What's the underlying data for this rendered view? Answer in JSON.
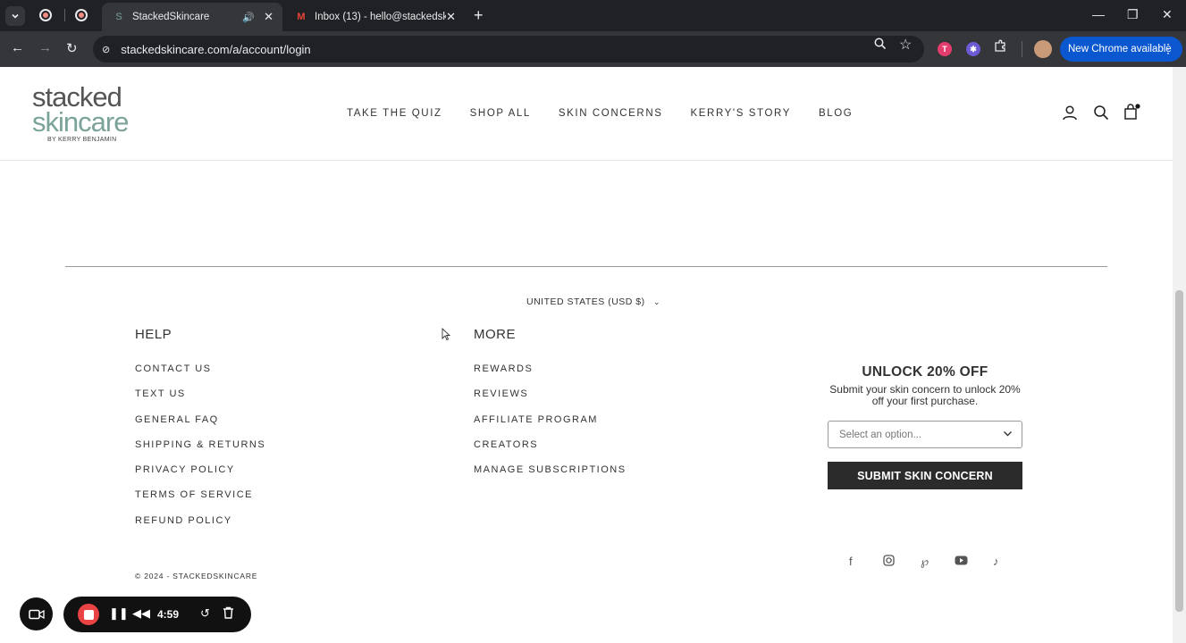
{
  "browser": {
    "tabs": [
      {
        "title": "StackedSkincare",
        "favicon": "S",
        "active": true
      },
      {
        "title": "Inbox (13) - hello@stackedskinc",
        "favicon": "M",
        "active": false
      }
    ],
    "url": "stackedskincare.com/a/account/login",
    "chrome_available_label": "New Chrome available",
    "extension_badge": "T"
  },
  "site": {
    "logo": {
      "line1": "stacked",
      "line2": "skincare",
      "line3": "BY KERRY BENJAMIN"
    },
    "nav": [
      {
        "label": "TAKE THE QUIZ"
      },
      {
        "label": "SHOP ALL"
      },
      {
        "label": "SKIN CONCERNS"
      },
      {
        "label": "KERRY'S STORY"
      },
      {
        "label": "BLOG"
      }
    ]
  },
  "footer": {
    "currency": "UNITED STATES (USD $)",
    "help": {
      "title": "HELP",
      "links": [
        "CONTACT US",
        "TEXT US",
        "GENERAL FAQ",
        "SHIPPING & RETURNS",
        "PRIVACY POLICY",
        "TERMS OF SERVICE",
        "REFUND POLICY"
      ]
    },
    "more": {
      "title": "MORE",
      "links": [
        "REWARDS",
        "REVIEWS",
        "AFFILIATE PROGRAM",
        "CREATORS",
        "MANAGE SUBSCRIPTIONS"
      ]
    },
    "promo": {
      "title": "UNLOCK 20% OFF",
      "text": "Submit your skin concern to unlock 20% off your first purchase.",
      "select_placeholder": "Select an option...",
      "submit_label": "SUBMIT SKIN CONCERN"
    },
    "copyright": "© 2024 - STACKEDSKINCARE"
  },
  "recorder": {
    "time": "4:59"
  }
}
